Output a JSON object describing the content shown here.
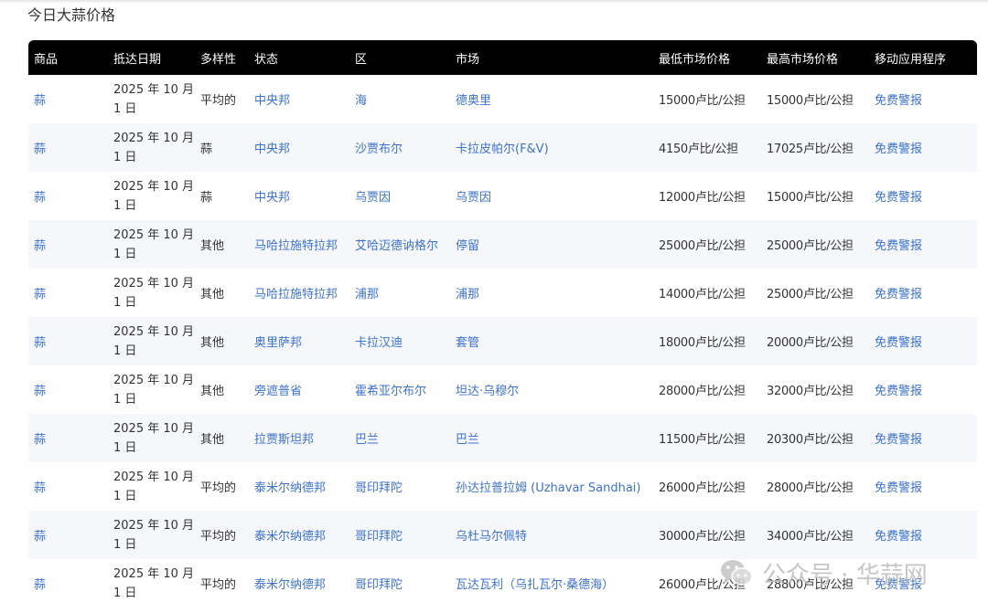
{
  "page_title": "今日大蒜价格",
  "table": {
    "headers": [
      "商品",
      "抵达日期",
      "多样性",
      "状态",
      "区",
      "市场",
      "最低市场价格",
      "最高市场价格",
      "移动应用程序"
    ],
    "rows": [
      {
        "commodity": "蒜",
        "date_line1": "2025 年 10 月",
        "date_line2": "1 日",
        "variety": "平均的",
        "state": "中央邦",
        "district": "海",
        "market": "德奥里",
        "min_price": "15000卢比/公担",
        "max_price": "15000卢比/公担",
        "app": "免费警报"
      },
      {
        "commodity": "蒜",
        "date_line1": "2025 年 10 月",
        "date_line2": "1 日",
        "variety": "蒜",
        "state": "中央邦",
        "district": "沙贾布尔",
        "market": "卡拉皮帕尔(F&V)",
        "min_price": "4150卢比/公担",
        "max_price": "17025卢比/公担",
        "app": "免费警报"
      },
      {
        "commodity": "蒜",
        "date_line1": "2025 年 10 月",
        "date_line2": "1 日",
        "variety": "蒜",
        "state": "中央邦",
        "district": "乌贾因",
        "market": "乌贾因",
        "min_price": "12000卢比/公担",
        "max_price": "15000卢比/公担",
        "app": "免费警报"
      },
      {
        "commodity": "蒜",
        "date_line1": "2025 年 10 月",
        "date_line2": "1 日",
        "variety": "其他",
        "state": "马哈拉施特拉邦",
        "district": "艾哈迈德讷格尔",
        "market": "停留",
        "min_price": "25000卢比/公担",
        "max_price": "25000卢比/公担",
        "app": "免费警报"
      },
      {
        "commodity": "蒜",
        "date_line1": "2025 年 10 月",
        "date_line2": "1 日",
        "variety": "其他",
        "state": "马哈拉施特拉邦",
        "district": "浦那",
        "market": "浦那",
        "min_price": "14000卢比/公担",
        "max_price": "25000卢比/公担",
        "app": "免费警报"
      },
      {
        "commodity": "蒜",
        "date_line1": "2025 年 10 月",
        "date_line2": "1 日",
        "variety": "其他",
        "state": "奥里萨邦",
        "district": "卡拉汉迪",
        "market": "套管",
        "min_price": "18000卢比/公担",
        "max_price": "20000卢比/公担",
        "app": "免费警报"
      },
      {
        "commodity": "蒜",
        "date_line1": "2025 年 10 月",
        "date_line2": "1 日",
        "variety": "其他",
        "state": "旁遮普省",
        "district": "霍希亚尔布尔",
        "market": "坦达·乌穆尔",
        "min_price": "28000卢比/公担",
        "max_price": "32000卢比/公担",
        "app": "免费警报"
      },
      {
        "commodity": "蒜",
        "date_line1": "2025 年 10 月",
        "date_line2": "1 日",
        "variety": "其他",
        "state": "拉贾斯坦邦",
        "district": "巴兰",
        "market": "巴兰",
        "min_price": "11500卢比/公担",
        "max_price": "20300卢比/公担",
        "app": "免费警报"
      },
      {
        "commodity": "蒜",
        "date_line1": "2025 年 10 月",
        "date_line2": "1 日",
        "variety": "平均的",
        "state": "泰米尔纳德邦",
        "district": "哥印拜陀",
        "market": "孙达拉普拉姆 (Uzhavar Sandhai)",
        "min_price": "26000卢比/公担",
        "max_price": "28000卢比/公担",
        "app": "免费警报"
      },
      {
        "commodity": "蒜",
        "date_line1": "2025 年 10 月",
        "date_line2": "1 日",
        "variety": "平均的",
        "state": "泰米尔纳德邦",
        "district": "哥印拜陀",
        "market": "乌杜马尔佩特",
        "min_price": "30000卢比/公担",
        "max_price": "34000卢比/公担",
        "app": "免费警报"
      },
      {
        "commodity": "蒜",
        "date_line1": "2025 年 10 月",
        "date_line2": "1 日",
        "variety": "平均的",
        "state": "泰米尔纳德邦",
        "district": "哥印拜陀",
        "market": "瓦达瓦利（乌扎瓦尔·桑德海）",
        "min_price": "26000卢比/公担",
        "max_price": "28800卢比/公担",
        "app": "免费警报"
      }
    ]
  },
  "watermark": {
    "text": "公众号 · 华蒜网",
    "icon": "wechat-icon"
  },
  "colors": {
    "link": "#3d72c9",
    "header_bg": "#000000",
    "stripe": "#f5f7fb"
  }
}
